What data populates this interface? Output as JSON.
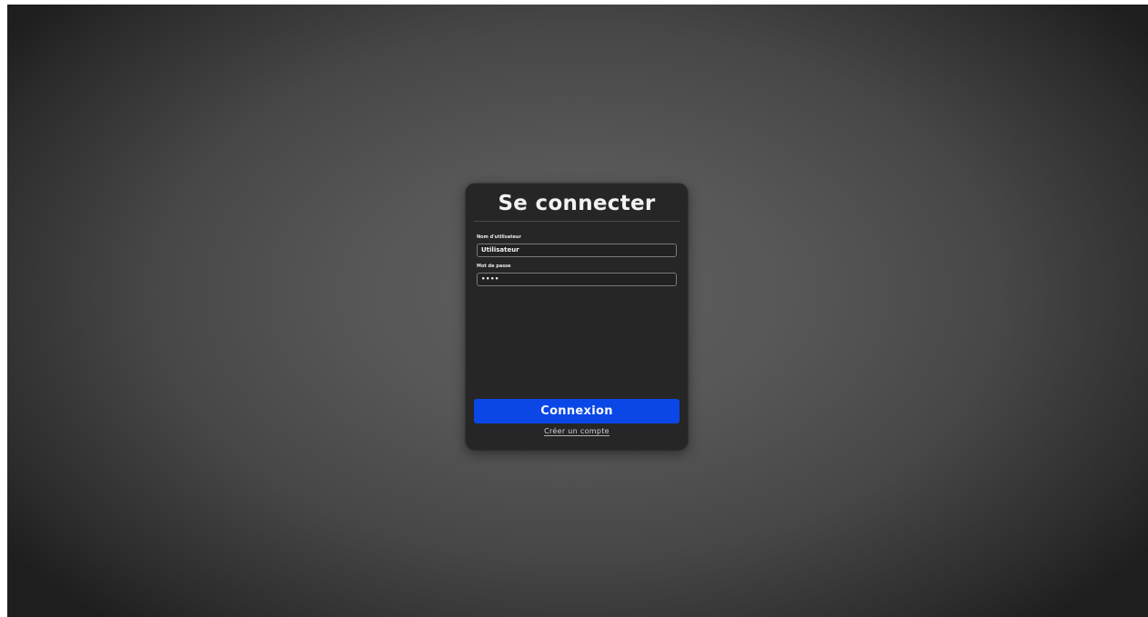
{
  "login": {
    "title": "Se connecter",
    "username": {
      "label": "Nom d'utilisateur",
      "value": "Utilisateur"
    },
    "password": {
      "label": "Mot de passe",
      "masked_value": "••••"
    },
    "submit_label": "Connexion",
    "signup_link": "Créer un compte"
  },
  "colors": {
    "accent": "#0a47e6",
    "card_background": "#262626"
  }
}
